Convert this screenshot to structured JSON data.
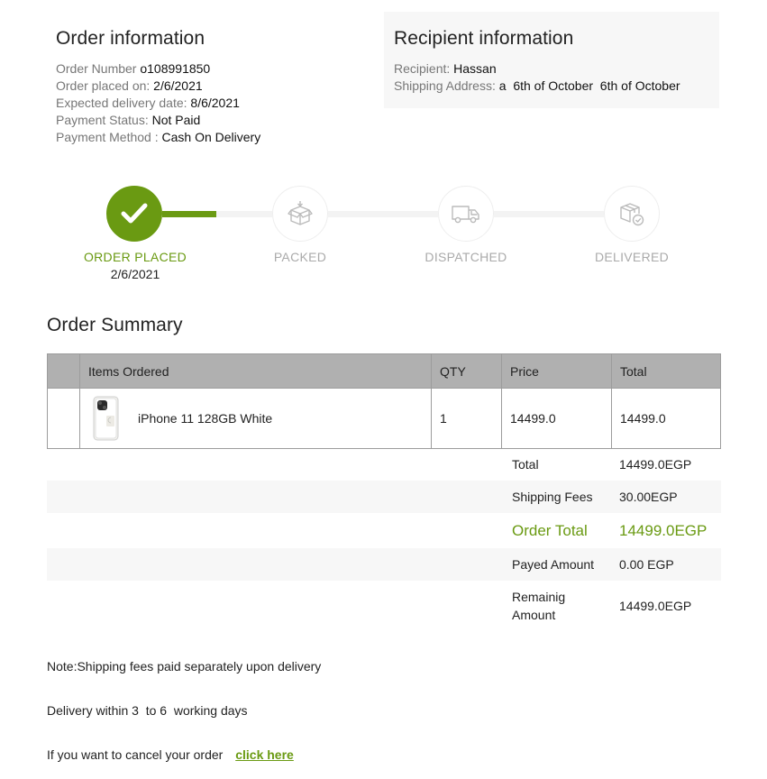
{
  "order_info": {
    "title": "Order information",
    "rows": [
      {
        "label": "Order Number ",
        "value": "o108991850"
      },
      {
        "label": "Order placed on: ",
        "value": "2/6/2021"
      },
      {
        "label": "Expected delivery date: ",
        "value": "8/6/2021"
      },
      {
        "label": "Payment Status: ",
        "value": "Not Paid"
      },
      {
        "label": "Payment Method : ",
        "value": "Cash On Delivery"
      }
    ]
  },
  "recipient_info": {
    "title": "Recipient information",
    "recipient_label": "Recipient: ",
    "recipient_value": "Hassan",
    "address_label": "Shipping Address: ",
    "address_value": "a  6th of October  6th of October"
  },
  "tracker": {
    "steps": [
      {
        "label": "ORDER PLACED",
        "date": "2/6/2021",
        "icon": "check-icon",
        "status": "done"
      },
      {
        "label": "PACKED",
        "date": "",
        "icon": "box-icon",
        "status": "pending"
      },
      {
        "label": "DISPATCHED",
        "date": "",
        "icon": "truck-icon",
        "status": "pending"
      },
      {
        "label": "DELIVERED",
        "date": "",
        "icon": "delivered-box-icon",
        "status": "pending"
      }
    ],
    "accent": "#6a9a12"
  },
  "summary": {
    "title": "Order Summary",
    "headers": {
      "items": "Items Ordered",
      "qty": "QTY",
      "price": "Price",
      "total": "Total"
    },
    "items": [
      {
        "name": "iPhone 11 128GB White",
        "qty": "1",
        "price": "14499.0",
        "total": "14499.0",
        "icon": "iphone-image"
      }
    ]
  },
  "totals": {
    "total_label": "Total",
    "total_value": "14499.0EGP",
    "shipping_label": "Shipping Fees",
    "shipping_value": "30.00EGP",
    "order_total_label": "Order Total",
    "order_total_value": "14499.0EGP",
    "payed_label": "Payed Amount",
    "payed_value": "0.00 EGP",
    "remaining_label_1": "Remainig",
    "remaining_label_2": "Amount",
    "remaining_value": "14499.0EGP"
  },
  "notes": {
    "shipping_note": "Note:Shipping fees paid separately upon delivery",
    "delivery_note": "Delivery within 3  to 6  working days",
    "cancel_text": "If you want to cancel your order",
    "cancel_link": "click here"
  }
}
